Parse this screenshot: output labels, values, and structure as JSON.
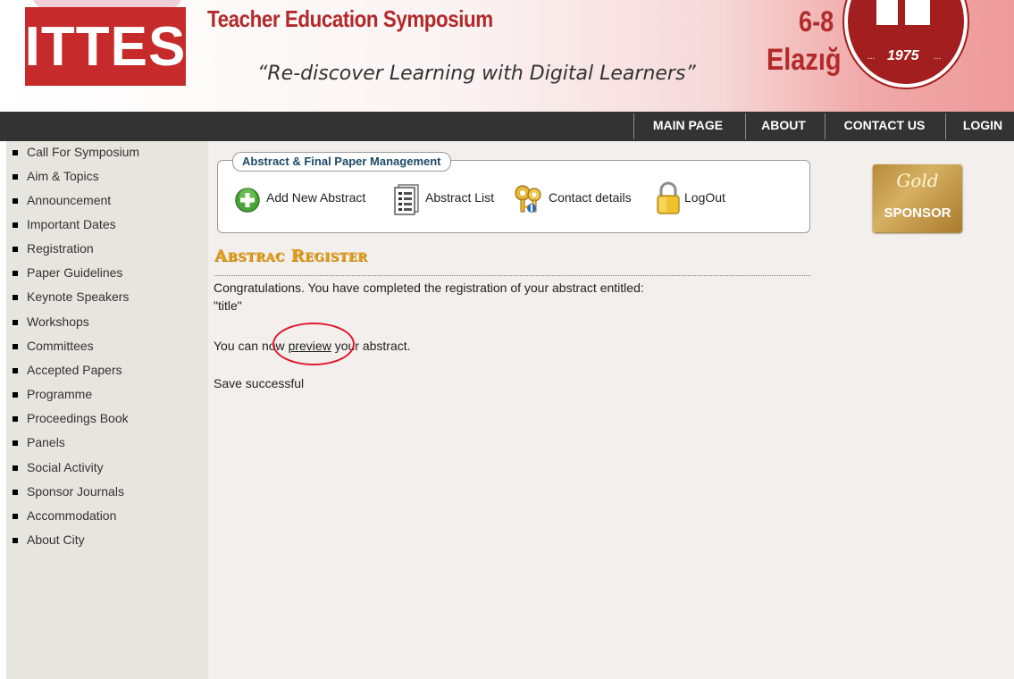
{
  "header": {
    "logo_text": "ITTES",
    "event_title": "Teacher Education Symposium",
    "tagline": "“Re-discover Learning with Digital Learners”",
    "dates": "6-8",
    "city": "Elazığ",
    "seal_year": "1975",
    "seal_dots": "..."
  },
  "nav": {
    "items": [
      {
        "label": "MAIN PAGE"
      },
      {
        "label": "ABOUT"
      },
      {
        "label": "CONTACT US"
      },
      {
        "label": "LOGIN"
      }
    ]
  },
  "sidebar": {
    "items": [
      {
        "label": "Call For Symposium"
      },
      {
        "label": "Aim & Topics"
      },
      {
        "label": "Announcement"
      },
      {
        "label": "Important Dates"
      },
      {
        "label": "Registration"
      },
      {
        "label": "Paper Guidelines"
      },
      {
        "label": "Keynote Speakers"
      },
      {
        "label": "Workshops"
      },
      {
        "label": "Committees"
      },
      {
        "label": "Accepted Papers"
      },
      {
        "label": "Programme"
      },
      {
        "label": "Proceedings Book"
      },
      {
        "label": "Panels"
      },
      {
        "label": "Social Activity"
      },
      {
        "label": "Sponsor Journals"
      },
      {
        "label": "Accommodation"
      },
      {
        "label": "About City"
      }
    ]
  },
  "management": {
    "legend": "Abstract & Final Paper Management",
    "actions": [
      {
        "label": "Add New Abstract",
        "icon": "plus-icon"
      },
      {
        "label": "Abstract List",
        "icon": "document-list-icon"
      },
      {
        "label": "Contact details",
        "icon": "keys-icon"
      },
      {
        "label": "LogOut",
        "icon": "padlock-icon"
      }
    ]
  },
  "content": {
    "heading": "Abstrac Register",
    "message_line1": "Congratulations. You have completed the registration of your abstract entitled:",
    "abstract_title": "\"title\"",
    "preview_before": "You can now ",
    "preview_link": "preview",
    "preview_after": " your abstract.",
    "save_status": "Save successful"
  },
  "sponsor": {
    "tier": "Gold",
    "label": "SPONSOR"
  },
  "colors": {
    "brand_red": "#c62a2a",
    "nav_bg": "#333333",
    "sidebar_bg": "#e7e5df",
    "heading_gold": "#e2a11d",
    "annotation_red": "#e0162b"
  }
}
